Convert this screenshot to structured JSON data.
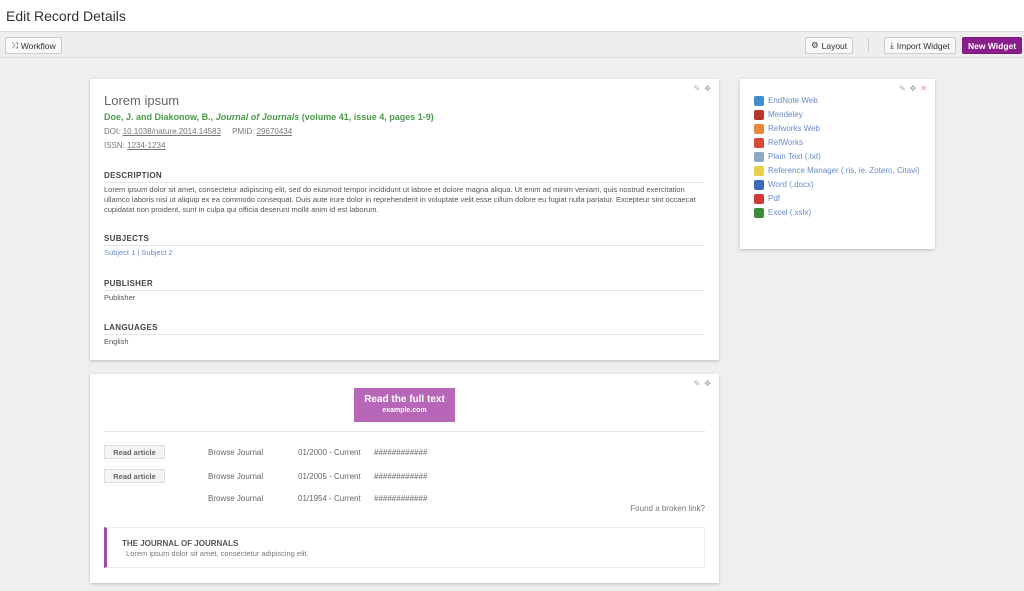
{
  "page_title": "Edit Record Details",
  "toolbar": {
    "workflow_label": "Workflow",
    "layout_label": "Layout",
    "import_widget_label": "Import Widget",
    "new_widget_label": "New Widget",
    "new_widget_color": "#8a1e8a"
  },
  "record": {
    "title": "Lorem ipsum",
    "authors": "Doe, J. and Diakonow, B.,",
    "journal": "Journal of Journals",
    "volume_info": "(volume 41, issue 4, pages 1-9)",
    "doi_label": "DOI:",
    "doi": "10.1038/nature.2014.14583",
    "pmid_label": "PMID:",
    "pmid": "29670434",
    "issn_label": "ISSN:",
    "issn": "1234-1234",
    "description_heading": "DESCRIPTION",
    "description": "Lorem ipsum dolor sit amet, consectetur adipiscing elit, sed do eiusmod tempor incididunt ut labore et dolore magna aliqua. Ut enim ad minim veniam, quis nostrud exercitation ullamco laboris nisi ut aliquip ex ea commodo consequat. Duis aute irure dolor in reprehenderit in voluptate velit esse cillum dolore eu fugiat nulla pariatur. Excepteur sint occaecat cupidatat non proident, sunt in culpa qui officia deserunt mollit anim id est laborum.",
    "subjects_heading": "SUBJECTS",
    "subjects": [
      "Subject 1",
      "Subject 2"
    ],
    "subject_separator": "|",
    "publisher_heading": "PUBLISHER",
    "publisher": "Publisher",
    "languages_heading": "LANGUAGES",
    "language": "English"
  },
  "exports": [
    {
      "label": "EndNote Web",
      "icon": "endnote-icon",
      "color": "#3d8fd0"
    },
    {
      "label": "Mendeley",
      "icon": "mendeley-icon",
      "color": "#b8352a"
    },
    {
      "label": "Refworks Web",
      "icon": "refworks-web-icon",
      "color": "#e8883a"
    },
    {
      "label": "RefWorks",
      "icon": "refworks-icon",
      "color": "#d94a3a"
    },
    {
      "label": "Plain Text (.txt)",
      "icon": "text-file-icon",
      "color": "#8aa8c8"
    },
    {
      "label": "Reference Manager (.ris, ie. Zotero, Citavi)",
      "icon": "lightbulb-icon",
      "color": "#e8d04a"
    },
    {
      "label": "Word (.docx)",
      "icon": "word-icon",
      "color": "#3a6ab8"
    },
    {
      "label": "Pdf",
      "icon": "pdf-icon",
      "color": "#d43a3a"
    },
    {
      "label": "Excel (.xslx)",
      "icon": "excel-icon",
      "color": "#3a8a3a"
    }
  ],
  "fulltext": {
    "button_title": "Read the full text",
    "button_domain": "example.com",
    "button_color": "#b866b8",
    "rows": [
      {
        "action": "Read article",
        "browse": "Browse Journal",
        "coverage": "01/2000 - Current",
        "code": "############"
      },
      {
        "action": "Read article",
        "browse": "Browse Journal",
        "coverage": "01/2005 - Current",
        "code": "############"
      },
      {
        "action": "",
        "browse": "Browse Journal",
        "coverage": "01/1954 - Current",
        "code": "############"
      }
    ],
    "broken_link": "Found a broken link?",
    "journal_name": "THE JOURNAL OF JOURNALS",
    "journal_desc": "Lorem ipsum dolor sit amet, consectetur adipiscing elit.",
    "accent_color": "#a04aa0"
  }
}
